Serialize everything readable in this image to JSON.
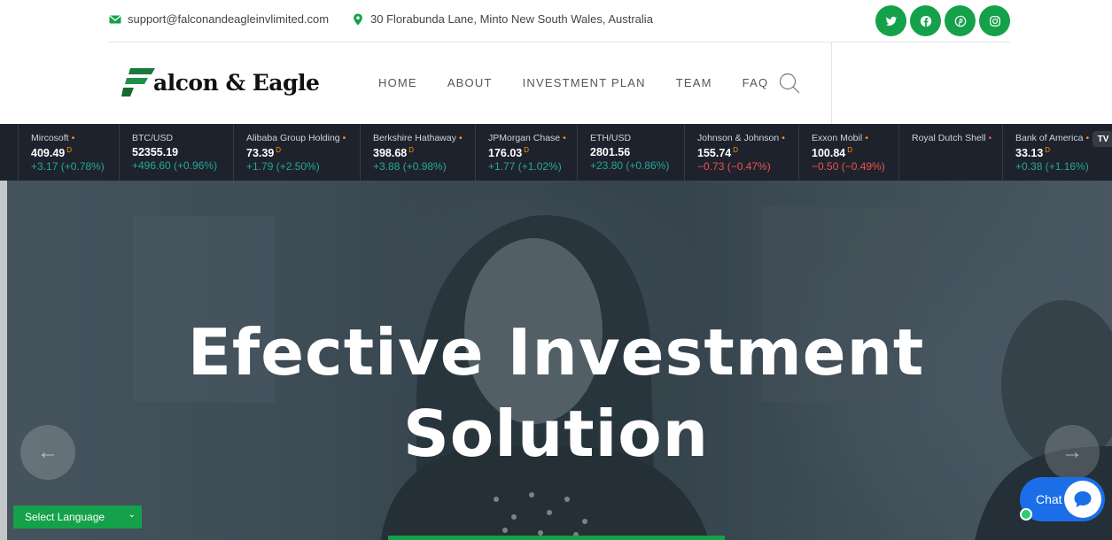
{
  "topbar": {
    "email": "support@falconandeagleinvlimited.com",
    "address": "30 Florabunda Lane, Minto New South Wales, Australia",
    "socials": [
      {
        "icon": "twitter-icon"
      },
      {
        "icon": "facebook-icon"
      },
      {
        "icon": "pinterest-icon"
      },
      {
        "icon": "instagram-icon"
      }
    ]
  },
  "header": {
    "logo_letter": "F",
    "logo_text": "alcon & Eagle",
    "nav": [
      "HOME",
      "ABOUT",
      "INVESTMENT PLAN",
      "TEAM",
      "FAQ"
    ]
  },
  "ticker": [
    {
      "name": "Mircosoft",
      "price": "409.49",
      "change": "+3.17 (+0.78%)",
      "dir": "up",
      "marker": "D"
    },
    {
      "name": "BTC/USD",
      "price": "52355.19",
      "change": "+496.60 (+0.96%)",
      "dir": "up",
      "marker": ""
    },
    {
      "name": "Alibaba Group Holding",
      "price": "73.39",
      "change": "+1.79 (+2.50%)",
      "dir": "up",
      "marker": "D"
    },
    {
      "name": "Berkshire Hathaway",
      "price": "398.68",
      "change": "+3.88 (+0.98%)",
      "dir": "up",
      "marker": "D"
    },
    {
      "name": "JPMorgan Chase",
      "price": "176.03",
      "change": "+1.77 (+1.02%)",
      "dir": "up",
      "marker": "D"
    },
    {
      "name": "ETH/USD",
      "price": "2801.56",
      "change": "+23.80 (+0.86%)",
      "dir": "up",
      "marker": ""
    },
    {
      "name": "Johnson & Johnson",
      "price": "155.74",
      "change": "−0.73 (−0.47%)",
      "dir": "down",
      "marker": "D"
    },
    {
      "name": "Exxon Mobil",
      "price": "100.84",
      "change": "−0.50 (−0.49%)",
      "dir": "down",
      "marker": "D"
    },
    {
      "name": "Royal Dutch Shell",
      "price": "",
      "change": "",
      "dir": "up",
      "marker": ""
    },
    {
      "name": "Bank of America",
      "price": "33.13",
      "change": "+0.38 (+1.16%)",
      "dir": "up",
      "marker": "D"
    }
  ],
  "ticker_brand": "TV",
  "hero": {
    "title_line1": "Efective Investment",
    "title_line2": "Solution",
    "prev_arrow": "←",
    "next_arrow": "→"
  },
  "language": {
    "label": "Select Language",
    "caret": "⌄"
  },
  "chat": {
    "label": "Chat"
  },
  "colors": {
    "brand_green": "#15a14a",
    "ticker_bg": "#1e222d",
    "chat_blue": "#1b6ee8",
    "up": "#26a69a",
    "down": "#ef5350"
  }
}
